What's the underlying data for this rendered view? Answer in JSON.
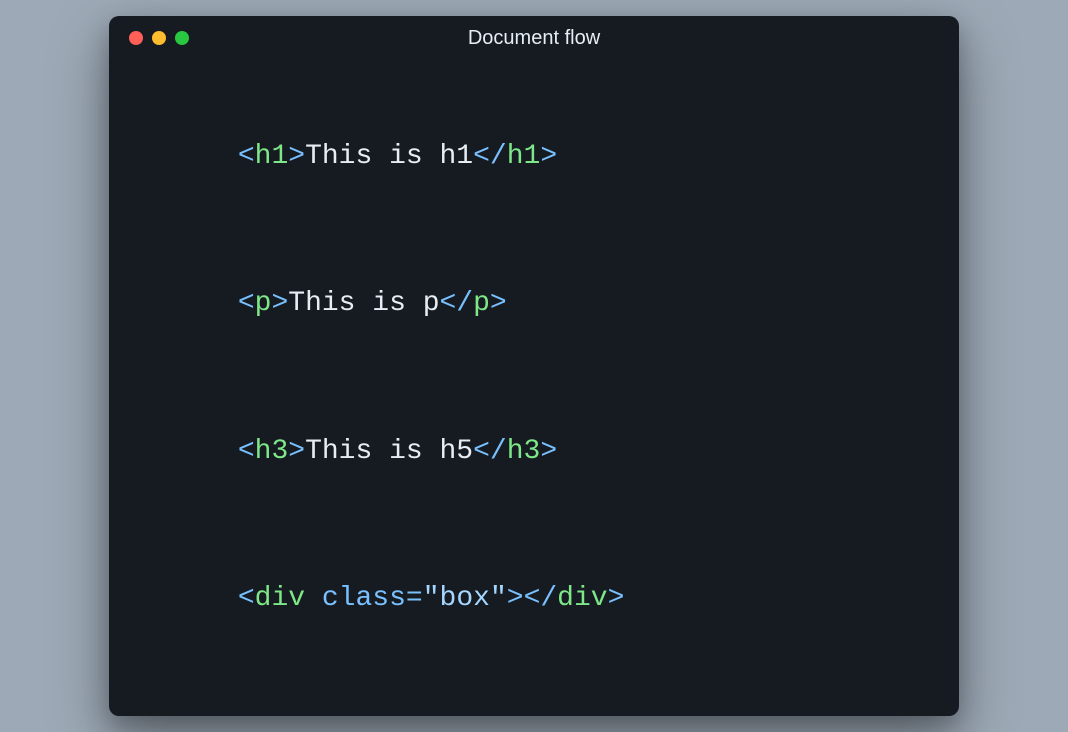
{
  "window": {
    "title": "Document flow"
  },
  "traffic": {
    "close": "#ff5f57",
    "min": "#febc2e",
    "max": "#28c840"
  },
  "code": {
    "lines": [
      {
        "open": "h1",
        "text": "This is h1",
        "close": "h1"
      },
      {
        "open": "p",
        "text": "This is p",
        "close": "p"
      },
      {
        "open": "h3",
        "text": "This is h5",
        "close": "h3"
      },
      {
        "open": "div",
        "attrName": "class",
        "attrVal": "box",
        "close": "div",
        "selfPair": true
      }
    ]
  }
}
